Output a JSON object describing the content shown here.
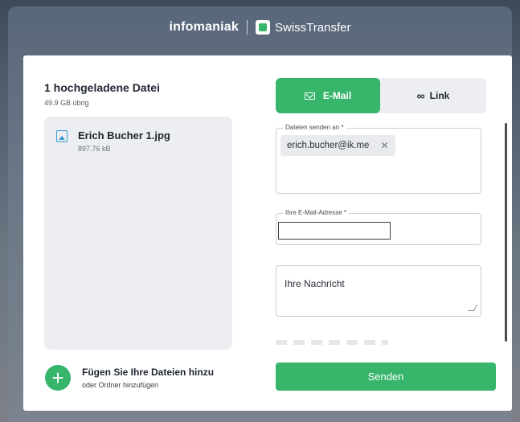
{
  "header": {
    "brand": "infomaniak",
    "product": "SwissTransfer"
  },
  "upload": {
    "title": "1 hochgeladene Datei",
    "remaining": "49.9 GB übrig",
    "files": [
      {
        "name": "Erich Bucher 1.jpg",
        "size": "897.76 kB"
      }
    ],
    "add_title": "Fügen Sie Ihre Dateien hinzu",
    "add_subtitle": "oder Ordner hinzufügen"
  },
  "tabs": {
    "email_label": "E-Mail",
    "link_label": "Link",
    "active": "email"
  },
  "form": {
    "recipients_label": "Dateien senden an *",
    "recipients": [
      "erich.bucher@ik.me"
    ],
    "sender_label": "Ihre E-Mail-Adresse *",
    "sender_value": "",
    "message_placeholder": "Ihre Nachricht",
    "send_label": "Senden"
  },
  "colors": {
    "accent": "#37b56b",
    "file_icon": "#3e9bd0"
  },
  "icons": {
    "file": "image-file-icon",
    "add": "plus-icon",
    "email_tab": "mail-icon",
    "link_tab": "link-icon",
    "chip_remove": "close-icon",
    "logo": "swisstransfer-logo-icon"
  }
}
